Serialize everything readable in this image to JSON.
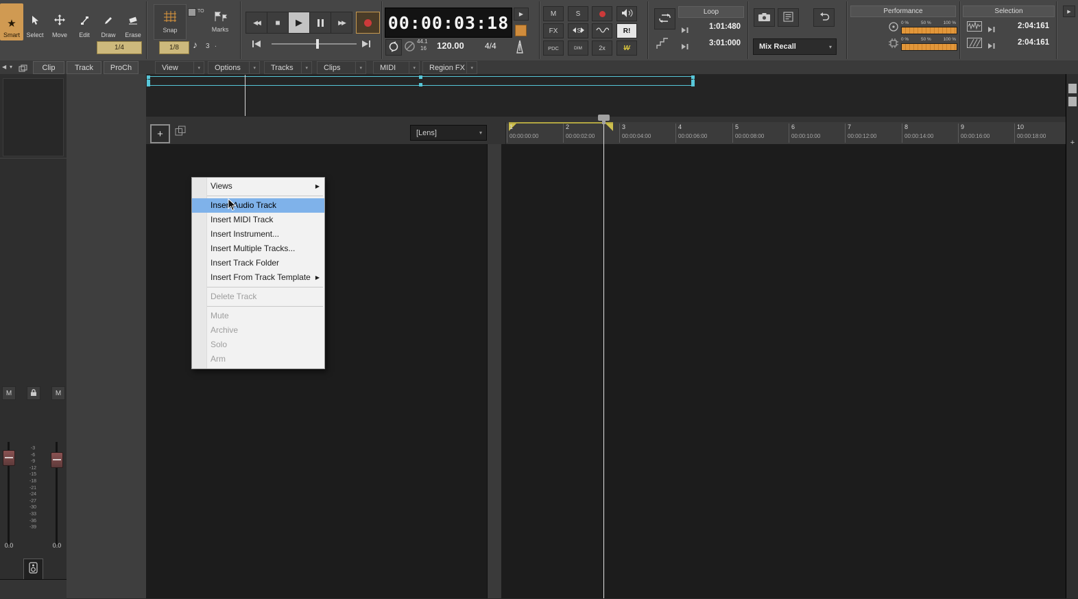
{
  "icons": {
    "star": "★",
    "rewind": "◀◀",
    "stop": "■",
    "play": "▶",
    "fast_forward": "▶▶",
    "chevron_down": "▾",
    "submenu_arrow": "▶",
    "note_eighth": "♪",
    "collapse_left": "◀",
    "plus": "+"
  },
  "tools": {
    "items": [
      {
        "label": "Smart"
      },
      {
        "label": "Select"
      },
      {
        "label": "Move"
      },
      {
        "label": "Edit"
      },
      {
        "label": "Draw"
      },
      {
        "label": "Erase"
      }
    ],
    "duration": "1/4"
  },
  "snap": {
    "label": "Snap",
    "to_label": "TO",
    "marks_label": "Marks",
    "resolution": "1/8",
    "triplet": "3",
    "dot": "."
  },
  "time": {
    "position": "00:00:03:18",
    "sample_rate": "44.1",
    "bit_depth": "16",
    "tempo": "120.00",
    "meter": "4/4"
  },
  "switches": {
    "mute": "M",
    "solo": "S",
    "fx": "FX",
    "exclusive_solo": "R!",
    "pdc": "PDC",
    "dim": "DIM",
    "double_speed": "2x",
    "w_automation": "W"
  },
  "loop": {
    "title": "Loop",
    "start": "1:01:480",
    "end": "3:01:000"
  },
  "mix": {
    "recall_label": "Mix Recall"
  },
  "performance": {
    "title": "Performance",
    "scale": {
      "p0": "0 %",
      "p50": "50 %",
      "p100": "100 %"
    }
  },
  "selection": {
    "title": "Selection",
    "start": "2:04:161",
    "end": "2:04:161"
  },
  "panel_tabs": [
    {
      "label": "Clip"
    },
    {
      "label": "Track"
    },
    {
      "label": "ProCh"
    }
  ],
  "menus": [
    {
      "label": "View"
    },
    {
      "label": "Options"
    },
    {
      "label": "Tracks"
    },
    {
      "label": "Clips"
    },
    {
      "label": "MIDI"
    },
    {
      "label": "Region FX"
    }
  ],
  "track_view": {
    "lens": "[Lens]"
  },
  "ruler": {
    "marks": [
      {
        "num": "1",
        "time": "00:00:00:00"
      },
      {
        "num": "2",
        "time": "00:00:02:00"
      },
      {
        "num": "3",
        "time": "00:00:04:00"
      },
      {
        "num": "4",
        "time": "00:00:06:00"
      },
      {
        "num": "5",
        "time": "00:00:08:00"
      },
      {
        "num": "6",
        "time": "00:00:10:00"
      },
      {
        "num": "7",
        "time": "00:00:12:00"
      },
      {
        "num": "8",
        "time": "00:00:14:00"
      },
      {
        "num": "9",
        "time": "00:00:16:00"
      },
      {
        "num": "10",
        "time": "00:00:18:00"
      }
    ]
  },
  "context_menu": {
    "items": [
      {
        "label": "Views",
        "submenu": true,
        "state": "normal"
      },
      {
        "label": "Insert Audio Track",
        "state": "highlighted"
      },
      {
        "label": "Insert MIDI Track",
        "state": "normal"
      },
      {
        "label": "Insert Instrument...",
        "state": "normal"
      },
      {
        "label": "Insert Multiple Tracks...",
        "state": "normal"
      },
      {
        "label": "Insert Track Folder",
        "state": "normal"
      },
      {
        "label": "Insert From Track Template",
        "submenu": true,
        "state": "normal"
      },
      {
        "label": "Delete Track",
        "state": "disabled"
      },
      {
        "label": "Mute",
        "state": "disabled"
      },
      {
        "label": "Archive",
        "state": "disabled"
      },
      {
        "label": "Solo",
        "state": "disabled"
      },
      {
        "label": "Arm",
        "state": "disabled"
      }
    ]
  },
  "inspector": {
    "mute_left": "M",
    "mute_right": "M",
    "db_scale": [
      "-3",
      "-6",
      "-9",
      "-12",
      "-15",
      "-18",
      "-21",
      "-24",
      "-27",
      "-30",
      "-33",
      "-36",
      "-39"
    ],
    "volume_left": "0.0",
    "volume_right": "0.0"
  },
  "colors": {
    "accent_orange": "#d09a52",
    "tan": "#cdb97c",
    "highlight_blue": "#7fb2ea",
    "selection_cyan": "#57c7d9",
    "record_red": "#cc3a3a",
    "loop_yellow": "#c8b84a"
  }
}
